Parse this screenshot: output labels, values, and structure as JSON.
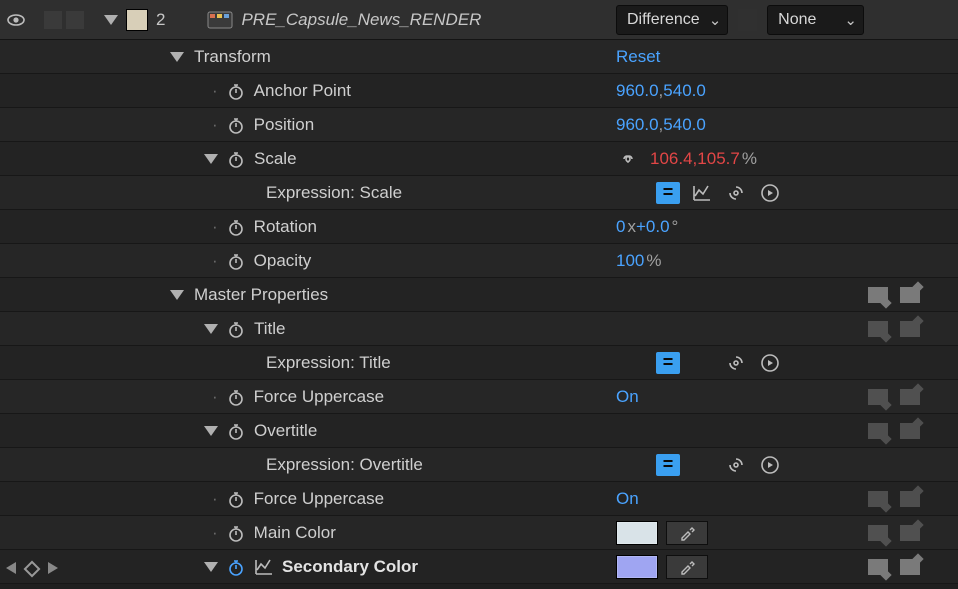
{
  "header": {
    "layer_index": "2",
    "layer_name": "PRE_Capsule_News_RENDER",
    "blend_mode": "Difference",
    "track_matte": "None"
  },
  "transform": {
    "group_label": "Transform",
    "reset_label": "Reset",
    "anchor_point": {
      "label": "Anchor Point",
      "x": "960.0",
      "y": "540.0"
    },
    "position": {
      "label": "Position",
      "x": "960.0",
      "y": "540.0"
    },
    "scale": {
      "label": "Scale",
      "x": "106.4",
      "y": "105.7",
      "unit": "%",
      "expression_label": "Expression: Scale"
    },
    "rotation": {
      "label": "Rotation",
      "turns": "0",
      "degrees": "+0.0",
      "unit": "°"
    },
    "opacity": {
      "label": "Opacity",
      "value": "100",
      "unit": "%"
    }
  },
  "master": {
    "group_label": "Master Properties",
    "title": {
      "label": "Title",
      "expression_label": "Expression: Title"
    },
    "force_uppercase_label": "Force Uppercase",
    "force_uppercase_value": "On",
    "overtitle": {
      "label": "Overtitle",
      "expression_label": "Expression: Overtitle"
    },
    "main_color": {
      "label": "Main Color",
      "value": "#d9e3e8"
    },
    "secondary_color": {
      "label": "Secondary Color",
      "value": "#9fa5f2"
    }
  }
}
